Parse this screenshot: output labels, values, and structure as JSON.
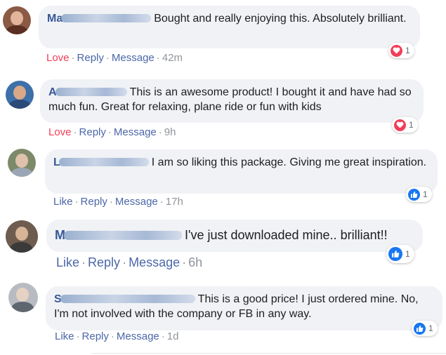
{
  "comments": [
    {
      "name": "Ma",
      "text": "Bought and really enjoying this. Absolutely brilliant.",
      "action": "Love",
      "reply": "Reply",
      "message": "Message",
      "time": "42m",
      "reaction_icon": "heart-icon",
      "reaction_count": "1"
    },
    {
      "name": "A",
      "text": "This is an awesome product! I bought it and have had so much fun. Great for relaxing, plane ride or fun with kids",
      "action": "Love",
      "reply": "Reply",
      "message": "Message",
      "time": "9h",
      "reaction_icon": "heart-icon",
      "reaction_count": "1"
    },
    {
      "name": "L",
      "text": "I am so liking this package. Giving me great inspiration.",
      "action": "Like",
      "reply": "Reply",
      "message": "Message",
      "time": "17h",
      "reaction_icon": "thumbs-up-icon",
      "reaction_count": "1"
    },
    {
      "name": "M",
      "text": "I've just downloaded mine.. brilliant!!",
      "action": "Like",
      "reply": "Reply",
      "message": "Message",
      "time": "6h",
      "reaction_icon": "thumbs-up-icon",
      "reaction_count": "1"
    },
    {
      "name": "S",
      "text": "This is a good price! I just ordered mine. No, I'm not involved with the company or FB in any way.",
      "action": "Like",
      "reply": "Reply",
      "message": "Message",
      "time": "1d",
      "reaction_icon": "thumbs-up-icon",
      "reaction_count": "1"
    }
  ],
  "separator": "·",
  "colors": {
    "name": "#385898",
    "action_link": "#4b67a8",
    "love": "#f33e58",
    "like": "#1877f2",
    "bubble": "#f0f2f5",
    "meta": "#90949c"
  }
}
